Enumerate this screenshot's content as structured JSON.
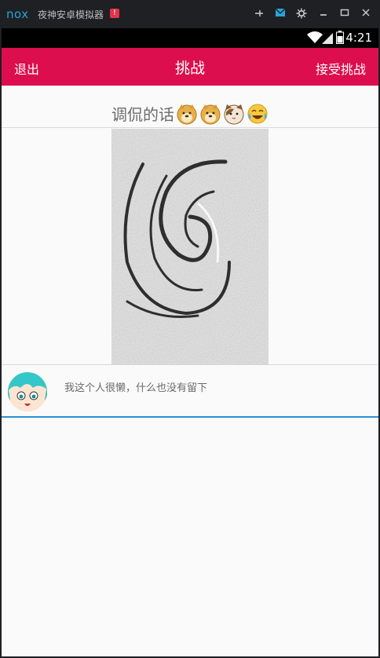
{
  "window": {
    "logo": "nox",
    "title": "夜神安卓模拟器",
    "alert_badge": "!"
  },
  "statusbar": {
    "time": "4:21"
  },
  "appbar": {
    "left_label": "退出",
    "title": "挑战",
    "right_label": "接受挑战",
    "color": "#dc0e4d"
  },
  "challenge": {
    "taunt_label": "调侃的话",
    "emojis": [
      "doge-face-icon",
      "doge-face-icon",
      "cat-face-icon",
      "tears-of-joy-icon"
    ]
  },
  "user": {
    "description": "我这个人很懒，什么也没有留下"
  },
  "colors": {
    "accent_line": "#2b8fd6",
    "text_gray": "#6c6c6c"
  }
}
